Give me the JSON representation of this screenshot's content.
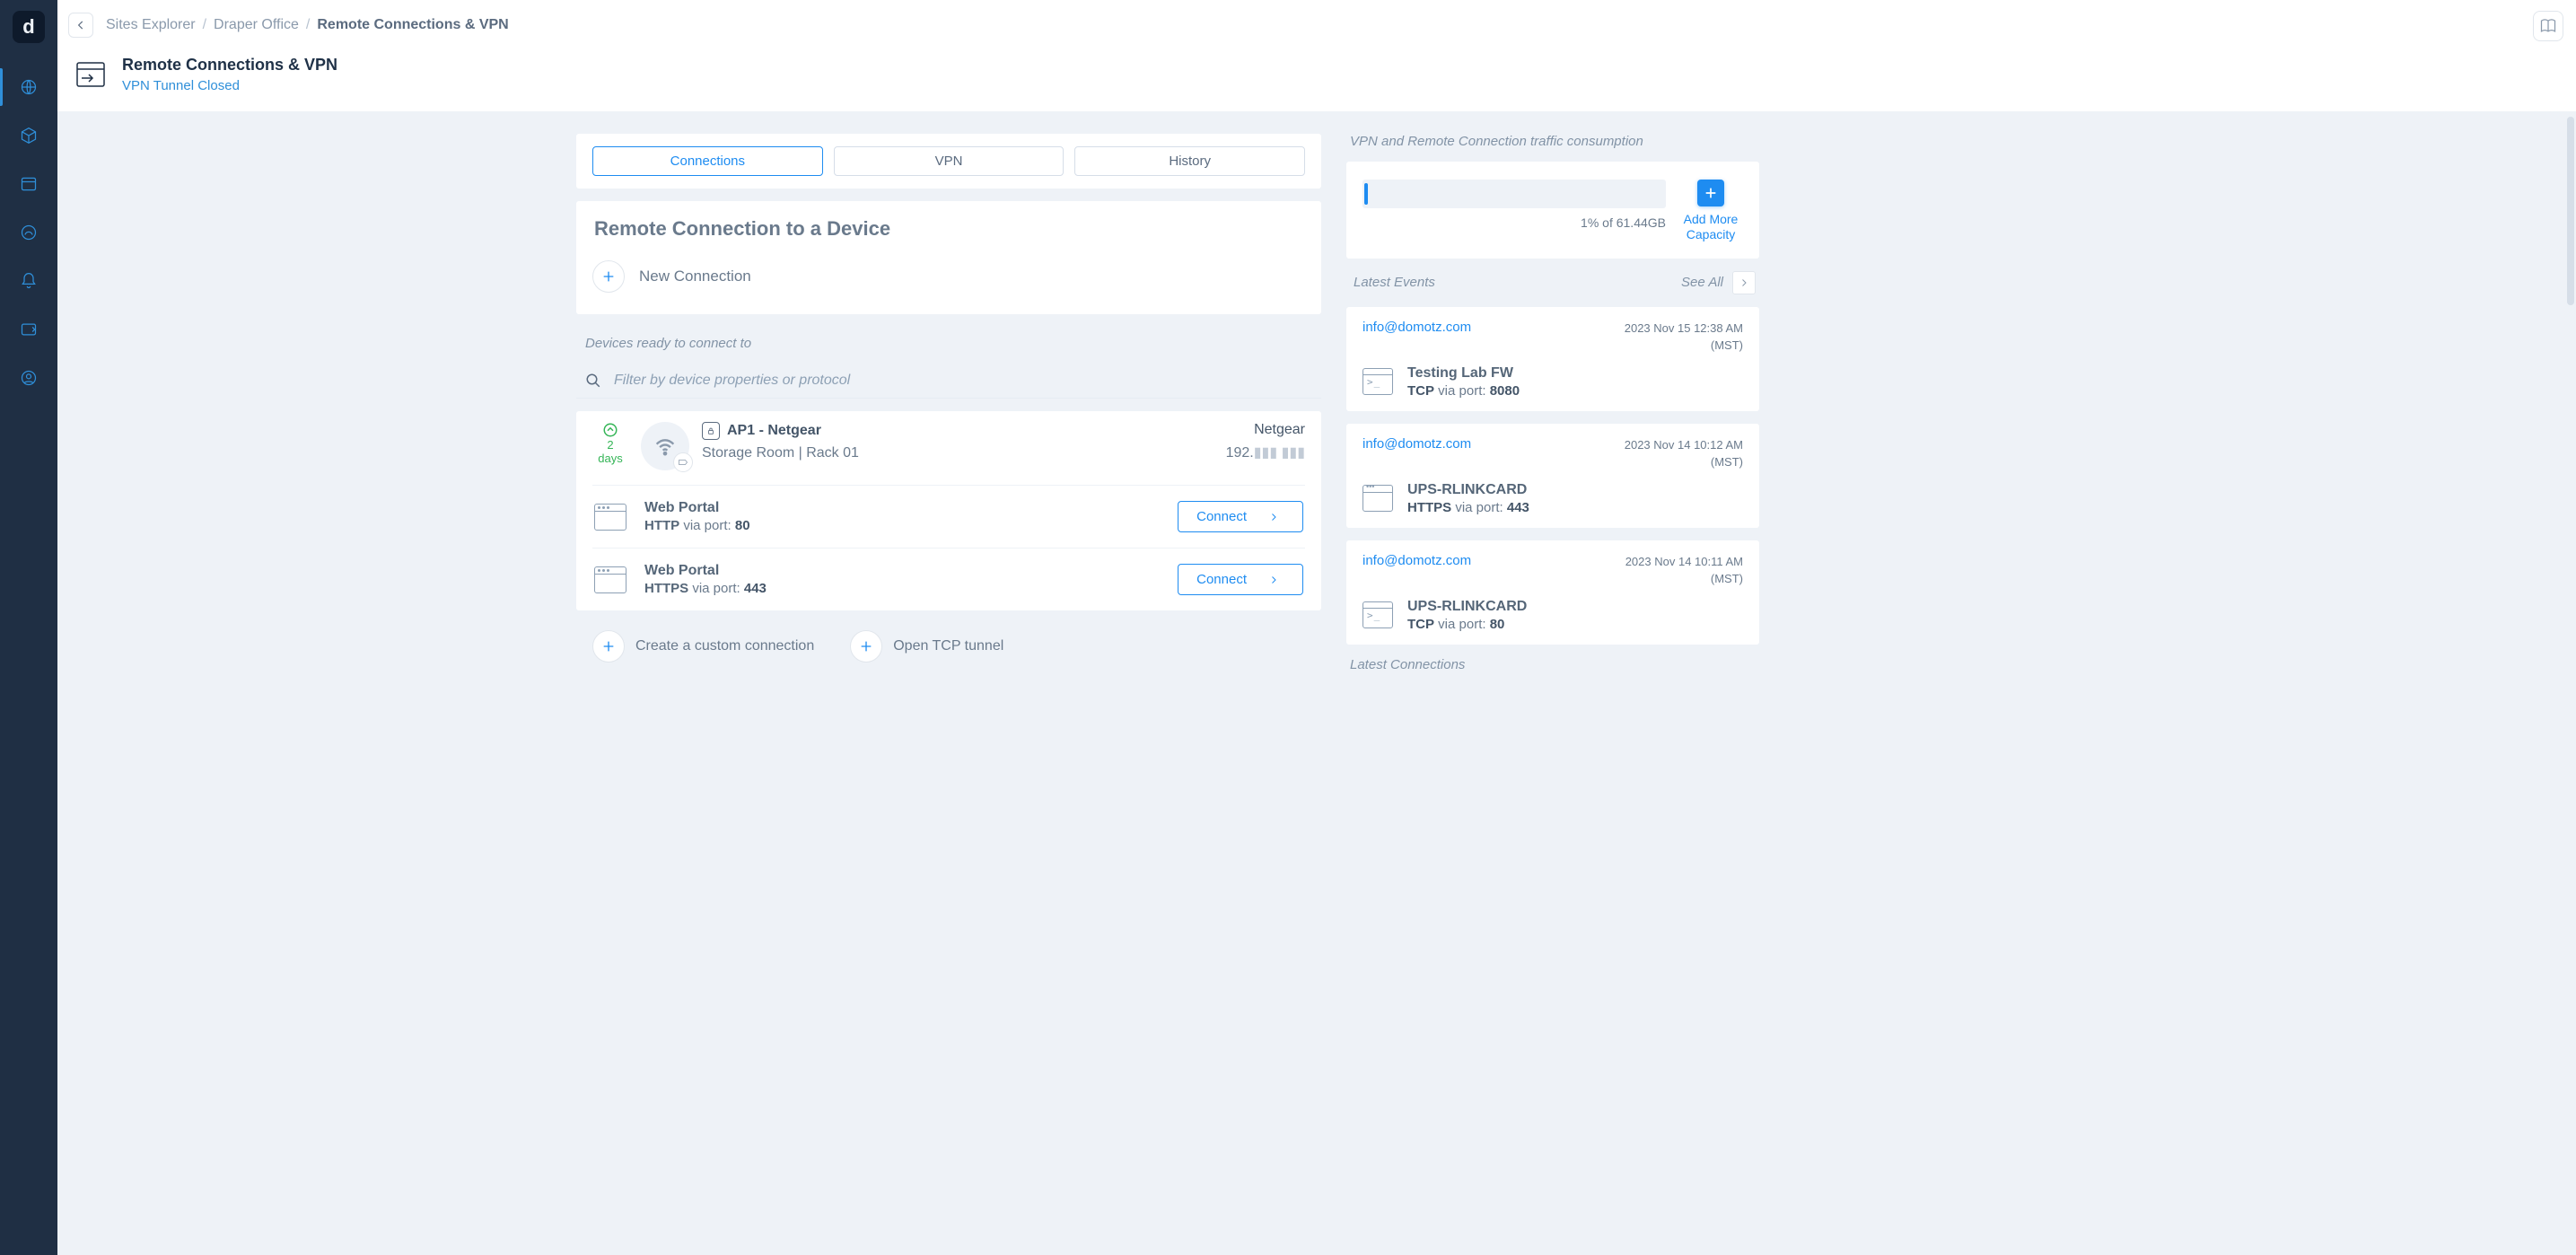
{
  "app": {
    "logo_letter": "d"
  },
  "breadcrumb": {
    "root": "Sites Explorer",
    "mid": "Draper Office",
    "current": "Remote Connections & VPN"
  },
  "page": {
    "title": "Remote Connections & VPN",
    "subtitle": "VPN Tunnel Closed"
  },
  "tabs": [
    {
      "label": "Connections",
      "active": true
    },
    {
      "label": "VPN",
      "active": false
    },
    {
      "label": "History",
      "active": false
    }
  ],
  "remote_connection": {
    "heading": "Remote Connection to a Device",
    "new_connection_label": "New Connection",
    "ready_hint": "Devices ready to connect to",
    "filter_placeholder": "Filter by device properties or protocol"
  },
  "device": {
    "uptime_value": "2",
    "uptime_unit": "days",
    "name": "AP1 - Netgear",
    "location": "Storage Room | Rack 01",
    "vendor": "Netgear",
    "ip_prefix": "192.",
    "ip_blurred": "▮▮▮ ▮▮▮",
    "connections": [
      {
        "title": "Web Portal",
        "protocol": "HTTP",
        "via": "via port:",
        "port": "80",
        "btn": "Connect"
      },
      {
        "title": "Web Portal",
        "protocol": "HTTPS",
        "via": "via port:",
        "port": "443",
        "btn": "Connect"
      }
    ]
  },
  "bottom_actions": {
    "custom": "Create a custom connection",
    "tcp": "Open TCP tunnel"
  },
  "consumption": {
    "title": "VPN and Remote Connection traffic consumption",
    "percent_text": "1% of 61.44GB",
    "add_more": "Add More Capacity"
  },
  "events": {
    "title": "Latest Events",
    "see_all": "See All",
    "items": [
      {
        "email": "info@domotz.com",
        "ts_line1": "2023 Nov 15 12:38 AM",
        "ts_line2": "(MST)",
        "icon": "term",
        "name": "Testing Lab FW",
        "proto": "TCP",
        "via": "via port:",
        "port": "8080"
      },
      {
        "email": "info@domotz.com",
        "ts_line1": "2023 Nov 14 10:12 AM",
        "ts_line2": "(MST)",
        "icon": "win",
        "name": "UPS-RLINKCARD",
        "proto": "HTTPS",
        "via": "via port:",
        "port": "443"
      },
      {
        "email": "info@domotz.com",
        "ts_line1": "2023 Nov 14 10:11 AM",
        "ts_line2": "(MST)",
        "icon": "term",
        "name": "UPS-RLINKCARD",
        "proto": "TCP",
        "via": "via port:",
        "port": "80"
      }
    ]
  },
  "latest_connections_title": "Latest Connections"
}
